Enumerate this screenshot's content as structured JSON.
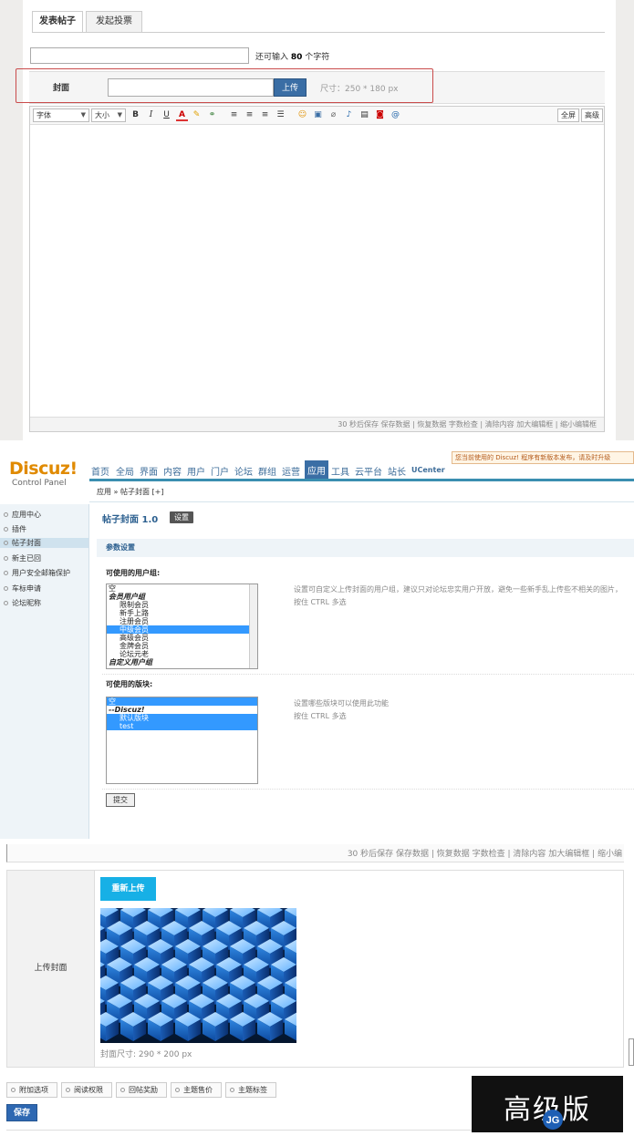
{
  "editor": {
    "tabs": [
      "发表帖子",
      "发起投票"
    ],
    "title_counter_prefix": "还可输入",
    "title_counter_num": "80",
    "title_counter_suffix": "个字符",
    "cover_label": "封面",
    "upload_label": "上传",
    "cover_size_hint": "尺寸：250 * 180 px",
    "toolbar": {
      "font_label": "字体",
      "size_label": "大小",
      "bold": "B",
      "italic": "I",
      "underline": "U",
      "fullscreen": "全屏",
      "advanced": "高级"
    },
    "footer": "30 秒后保存 保存数据 | 恢复数据    字数检查 | 清除内容    加大编辑框 | 缩小编辑框"
  },
  "admin": {
    "logo": "Discuz!",
    "logo_sub": "Control Panel",
    "nav": [
      "首页",
      "全局",
      "界面",
      "内容",
      "用户",
      "门户",
      "论坛",
      "群组",
      "运营",
      "应用",
      "工具",
      "云平台",
      "站长",
      "UCenter"
    ],
    "active_nav": "应用",
    "notice": "您当前使用的 Discuz! 程序有新版本发布，请及时升级",
    "breadcrumb": "应用 » 帖子封面 [+]",
    "sidebar": [
      "应用中心",
      "插件",
      "帖子封面",
      "新主已回",
      "用户安全邮箱保护",
      "车标申请",
      "论坛昵称"
    ],
    "active_sidebar": "帖子封面",
    "plugin_title": "帖子封面  1.0",
    "plugin_set": "设置",
    "param_section": "参数设置",
    "groups_label": "可使用的用户组:",
    "groups_options": [
      "空",
      "会员用户组",
      "限制会员",
      "新手上路",
      "注册会员",
      "中级会员",
      "高级会员",
      "金牌会员",
      "论坛元老",
      "自定义用户组"
    ],
    "groups_desc": "设置可自定义上传封面的用户组，建议只对论坛忠实用户开放，避免一些新手乱上传些不相关的图片，按住  CTRL 多选",
    "forums_label": "可使用的版块:",
    "forums_options": [
      "空",
      "--Discuz!",
      "默认版块",
      "test"
    ],
    "forums_desc": "设置哪些版块可以使用此功能\n按住  CTRL 多选",
    "submit": "提交"
  },
  "upload": {
    "footer": "30 秒后保存 保存数据 | 恢复数据    字数检查 | 清除内容    加大编辑框 | 缩小编",
    "row_label": "上传封面",
    "reupload": "重新上传",
    "cover_dims": "封面尺寸: 290 * 200 px",
    "options": [
      "附加选项",
      "阅读权限",
      "回帖奖励",
      "主题售价",
      "主题标签"
    ],
    "save": "保存",
    "watermark": "高级版",
    "watermark_logo": "JG"
  },
  "colors": {
    "accent_blue": "#3a6ea5",
    "highlight_red": "#c94b4b",
    "logo_orange": "#e08a00",
    "reupload_cyan": "#17b0e6",
    "save_blue": "#2e68b2"
  }
}
